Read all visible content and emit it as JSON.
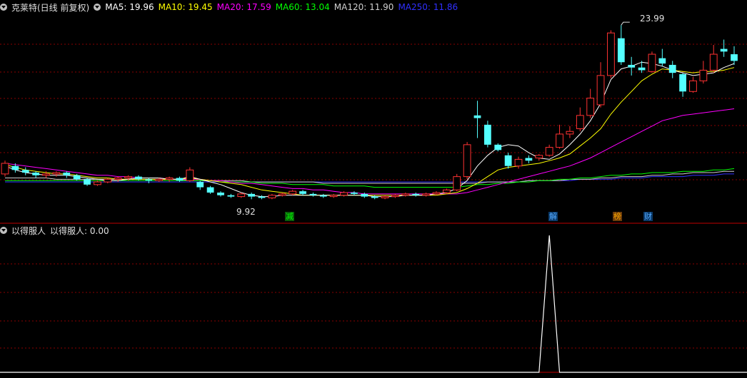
{
  "main": {
    "title": "克莱特(日线 前复权)",
    "ma": [
      {
        "label": "MA5: 19.96",
        "color": "#ffffff"
      },
      {
        "label": "MA10: 19.45",
        "color": "#ffff00"
      },
      {
        "label": "MA20: 17.59",
        "color": "#ff00ff"
      },
      {
        "label": "MA60: 13.04",
        "color": "#00ff00"
      },
      {
        "label": "MA120: 11.90",
        "color": "#d0d0d0"
      },
      {
        "label": "MA250: 11.86",
        "color": "#3030ff"
      }
    ],
    "high_label": "23.99",
    "low_label": "9.92",
    "event_tags": [
      {
        "text": "减",
        "bg": "#0a5a0a",
        "fg": "#00ff00"
      },
      {
        "text": "解",
        "bg": "#0a3a6a",
        "fg": "#55aaff"
      },
      {
        "text": "榜",
        "bg": "#6a3a0a",
        "fg": "#ffaa00"
      },
      {
        "text": "财",
        "bg": "#0a3a6a",
        "fg": "#55aaff"
      }
    ]
  },
  "sub": {
    "title": "以得服人",
    "value_label": "以得服人: 0.00"
  },
  "colors": {
    "up": "#ff3232",
    "down": "#54ffff",
    "grid": "#8a0000",
    "axis": "#c00000"
  },
  "chart_data": {
    "type": "candlestick",
    "price_range": [
      9.9,
      24.0
    ],
    "candles": [
      [
        12.8,
        13.6,
        13.8,
        12.6
      ],
      [
        13.4,
        13.1,
        13.6,
        12.9
      ],
      [
        13.1,
        12.9,
        13.3,
        12.7
      ],
      [
        12.9,
        12.7,
        13.0,
        12.5
      ],
      [
        12.7,
        12.8,
        13.0,
        12.5
      ],
      [
        12.8,
        12.9,
        13.0,
        12.6
      ],
      [
        12.9,
        12.7,
        13.0,
        12.5
      ],
      [
        12.7,
        12.4,
        12.8,
        12.3
      ],
      [
        12.4,
        12.0,
        12.5,
        11.9
      ],
      [
        12.0,
        12.2,
        12.3,
        11.9
      ],
      [
        12.2,
        12.4,
        12.5,
        12.1
      ],
      [
        12.4,
        12.5,
        12.6,
        12.2
      ],
      [
        12.5,
        12.6,
        12.7,
        12.3
      ],
      [
        12.6,
        12.4,
        12.7,
        12.3
      ],
      [
        12.4,
        12.3,
        12.5,
        12.1
      ],
      [
        12.3,
        12.4,
        12.5,
        12.2
      ],
      [
        12.4,
        12.5,
        12.6,
        12.2
      ],
      [
        12.5,
        12.3,
        12.6,
        12.2
      ],
      [
        12.3,
        13.1,
        13.3,
        12.2
      ],
      [
        12.2,
        11.8,
        12.3,
        11.6
      ],
      [
        11.8,
        11.4,
        11.9,
        11.3
      ],
      [
        11.4,
        11.2,
        11.5,
        11.1
      ],
      [
        11.2,
        11.1,
        11.3,
        11.0
      ],
      [
        11.1,
        11.3,
        11.4,
        11.0
      ],
      [
        11.3,
        11.1,
        11.4,
        10.9
      ],
      [
        11.1,
        11.0,
        11.2,
        10.9
      ],
      [
        11.0,
        11.2,
        11.3,
        10.9
      ],
      [
        11.2,
        11.3,
        11.4,
        11.1
      ],
      [
        11.3,
        11.5,
        11.6,
        11.2
      ],
      [
        11.5,
        11.3,
        11.6,
        11.2
      ],
      [
        11.3,
        11.2,
        11.4,
        11.1
      ],
      [
        11.2,
        11.1,
        11.3,
        11.0
      ],
      [
        11.1,
        11.2,
        11.3,
        11.0
      ],
      [
        11.2,
        11.4,
        11.5,
        11.1
      ],
      [
        11.4,
        11.3,
        11.5,
        11.2
      ],
      [
        11.3,
        11.1,
        11.4,
        11.0
      ],
      [
        11.1,
        11.0,
        11.2,
        10.9
      ],
      [
        11.0,
        11.1,
        11.2,
        10.9
      ],
      [
        11.1,
        11.2,
        11.3,
        11.0
      ],
      [
        11.2,
        11.3,
        11.4,
        11.1
      ],
      [
        11.3,
        11.2,
        11.4,
        11.1
      ],
      [
        11.2,
        11.3,
        11.4,
        11.1
      ],
      [
        11.3,
        11.4,
        11.5,
        11.2
      ],
      [
        11.4,
        11.6,
        11.7,
        11.3
      ],
      [
        11.6,
        12.6,
        12.8,
        11.5
      ],
      [
        12.6,
        15.0,
        15.2,
        12.4
      ],
      [
        17.2,
        17.0,
        18.3,
        15.5
      ],
      [
        16.5,
        15.0,
        16.8,
        14.8
      ],
      [
        15.0,
        14.6,
        15.1,
        14.5
      ],
      [
        14.2,
        13.4,
        14.4,
        13.2
      ],
      [
        13.4,
        13.9,
        14.1,
        13.2
      ],
      [
        14.0,
        13.8,
        14.2,
        13.6
      ],
      [
        14.0,
        14.2,
        14.3,
        13.8
      ],
      [
        14.2,
        14.8,
        15.0,
        14.1
      ],
      [
        14.8,
        15.8,
        16.5,
        14.7
      ],
      [
        15.8,
        16.0,
        16.4,
        15.5
      ],
      [
        16.2,
        17.2,
        17.8,
        16.0
      ],
      [
        17.2,
        18.5,
        19.2,
        17.0
      ],
      [
        18.0,
        20.2,
        21.2,
        17.8
      ],
      [
        20.2,
        23.4,
        23.6,
        20.0
      ],
      [
        23.0,
        21.2,
        23.99,
        21.0
      ],
      [
        21.0,
        20.8,
        21.6,
        20.2
      ],
      [
        20.8,
        20.6,
        21.3,
        20.4
      ],
      [
        20.5,
        21.8,
        22.0,
        20.4
      ],
      [
        21.5,
        21.1,
        22.2,
        20.9
      ],
      [
        21.0,
        20.4,
        21.3,
        20.0
      ],
      [
        20.3,
        19.0,
        20.4,
        18.6
      ],
      [
        19.0,
        19.8,
        20.1,
        18.9
      ],
      [
        19.8,
        20.6,
        21.3,
        19.6
      ],
      [
        20.6,
        21.8,
        22.5,
        20.4
      ],
      [
        22.2,
        22.0,
        22.9,
        21.6
      ],
      [
        21.8,
        21.3,
        22.4,
        21.0
      ]
    ],
    "ma5": [
      13.4,
      13.1,
      12.9,
      12.8,
      12.7,
      12.7,
      12.7,
      12.6,
      12.5,
      12.4,
      12.3,
      12.3,
      12.4,
      12.5,
      12.5,
      12.5,
      12.4,
      12.4,
      12.6,
      12.4,
      12.2,
      12.0,
      11.7,
      11.4,
      11.2,
      11.1,
      11.1,
      11.2,
      11.2,
      11.2,
      11.2,
      11.2,
      11.2,
      11.2,
      11.2,
      11.2,
      11.1,
      11.1,
      11.1,
      11.2,
      11.2,
      11.2,
      11.3,
      11.4,
      11.7,
      12.3,
      13.4,
      14.2,
      14.8,
      15.0,
      14.9,
      14.4,
      14.0,
      13.9,
      14.3,
      15.0,
      15.8,
      16.8,
      18.1,
      19.9,
      20.7,
      20.9,
      21.2,
      21.1,
      20.9,
      20.6,
      20.4,
      20.2,
      20.3,
      20.4,
      20.8,
      21.1
    ],
    "ma10": [
      13.5,
      13.3,
      13.1,
      13.0,
      12.9,
      12.8,
      12.8,
      12.7,
      12.6,
      12.5,
      12.5,
      12.4,
      12.4,
      12.4,
      12.4,
      12.4,
      12.4,
      12.4,
      12.5,
      12.4,
      12.3,
      12.2,
      12.1,
      12.0,
      11.8,
      11.6,
      11.5,
      11.4,
      11.3,
      11.2,
      11.2,
      11.2,
      11.2,
      11.2,
      11.2,
      11.2,
      11.2,
      11.2,
      11.2,
      11.2,
      11.2,
      11.2,
      11.2,
      11.3,
      11.4,
      11.7,
      12.1,
      12.6,
      13.1,
      13.3,
      13.4,
      13.5,
      13.6,
      13.8,
      14.0,
      14.3,
      14.9,
      15.5,
      16.2,
      17.3,
      18.2,
      19.0,
      19.8,
      20.3,
      20.7,
      20.6,
      20.5,
      20.4,
      20.5,
      20.5,
      20.6,
      20.8
    ],
    "ma20": [
      13.6,
      13.5,
      13.4,
      13.3,
      13.2,
      13.1,
      13.0,
      12.9,
      12.8,
      12.7,
      12.7,
      12.6,
      12.6,
      12.5,
      12.5,
      12.5,
      12.4,
      12.4,
      12.4,
      12.4,
      12.3,
      12.3,
      12.2,
      12.1,
      12.1,
      12.0,
      11.9,
      11.8,
      11.7,
      11.7,
      11.6,
      11.6,
      11.5,
      11.4,
      11.4,
      11.3,
      11.3,
      11.3,
      11.3,
      11.3,
      11.3,
      11.3,
      11.3,
      11.3,
      11.3,
      11.4,
      11.6,
      11.8,
      12.0,
      12.2,
      12.4,
      12.6,
      12.8,
      13.0,
      13.2,
      13.4,
      13.7,
      14.0,
      14.4,
      14.8,
      15.2,
      15.6,
      16.0,
      16.4,
      16.8,
      17.0,
      17.2,
      17.3,
      17.4,
      17.5,
      17.6,
      17.7
    ],
    "ma60": [
      12.3,
      12.3,
      12.3,
      12.3,
      12.3,
      12.3,
      12.3,
      12.3,
      12.3,
      12.3,
      12.3,
      12.3,
      12.3,
      12.3,
      12.3,
      12.3,
      12.3,
      12.3,
      12.3,
      12.3,
      12.3,
      12.2,
      12.2,
      12.2,
      12.2,
      12.1,
      12.1,
      12.1,
      12.0,
      12.0,
      12.0,
      12.0,
      11.9,
      11.9,
      11.9,
      11.9,
      11.8,
      11.8,
      11.8,
      11.8,
      11.8,
      11.8,
      11.8,
      11.8,
      11.8,
      11.9,
      12.0,
      12.0,
      12.1,
      12.1,
      12.2,
      12.2,
      12.3,
      12.3,
      12.4,
      12.4,
      12.5,
      12.5,
      12.6,
      12.7,
      12.7,
      12.8,
      12.8,
      12.9,
      12.9,
      12.9,
      13.0,
      13.0,
      13.0,
      13.1,
      13.1,
      13.2
    ],
    "ma120": [
      12.5,
      12.5,
      12.5,
      12.5,
      12.5,
      12.4,
      12.4,
      12.4,
      12.4,
      12.4,
      12.4,
      12.4,
      12.4,
      12.4,
      12.4,
      12.4,
      12.4,
      12.4,
      12.3,
      12.3,
      12.3,
      12.3,
      12.3,
      12.3,
      12.2,
      12.2,
      12.2,
      12.2,
      12.2,
      12.2,
      12.2,
      12.1,
      12.1,
      12.1,
      12.1,
      12.1,
      12.1,
      12.1,
      12.1,
      12.1,
      12.1,
      12.1,
      12.1,
      12.1,
      12.1,
      12.1,
      12.1,
      12.2,
      12.2,
      12.2,
      12.2,
      12.3,
      12.3,
      12.3,
      12.3,
      12.4,
      12.4,
      12.4,
      12.5,
      12.5,
      12.6,
      12.6,
      12.6,
      12.7,
      12.7,
      12.8,
      12.8,
      12.9,
      12.9,
      12.9,
      13.0,
      13.0
    ],
    "ma250": [
      12.2,
      12.2,
      12.2,
      12.2,
      12.2,
      12.2,
      12.2,
      12.2,
      12.2,
      12.2,
      12.2,
      12.2,
      12.2,
      12.2,
      12.2,
      12.2,
      12.2,
      12.2,
      12.2,
      12.2,
      12.2,
      12.2,
      12.2,
      12.2,
      12.2,
      12.2,
      12.2,
      12.2,
      12.2,
      12.2,
      12.2,
      12.2,
      12.2,
      12.2,
      12.2,
      12.2,
      12.2,
      12.2,
      12.2,
      12.2,
      12.2,
      12.2,
      12.2,
      12.2,
      12.2,
      12.2,
      12.2,
      12.2,
      12.2,
      12.2,
      12.2,
      12.3,
      12.3,
      12.3,
      12.3,
      12.3,
      12.4,
      12.4,
      12.4,
      12.4,
      12.5,
      12.5,
      12.5,
      12.6,
      12.6,
      12.6,
      12.6,
      12.7,
      12.7,
      12.7,
      12.8,
      12.8
    ],
    "event_index": [
      27,
      52,
      58,
      61
    ],
    "indicator": {
      "series": "以得服人",
      "values_nonzero": {
        "index": 53,
        "value": 1.0
      },
      "range": [
        0,
        1
      ]
    }
  }
}
